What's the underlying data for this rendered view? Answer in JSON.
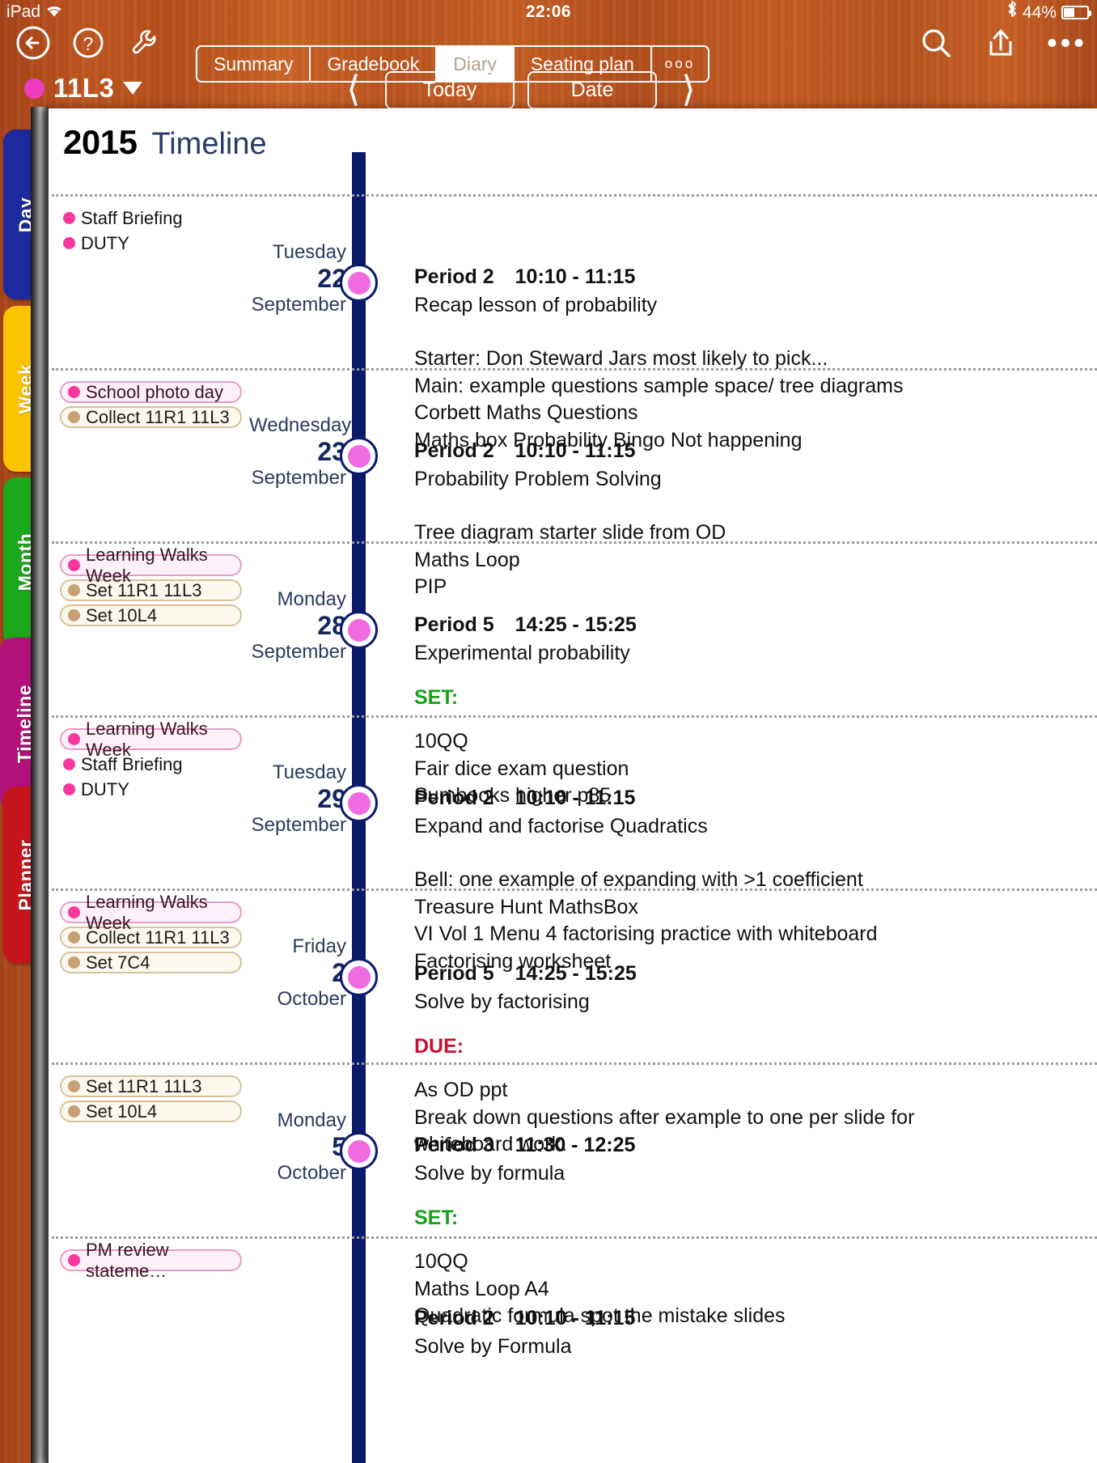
{
  "status_bar": {
    "device": "iPad",
    "wifi_icon": "wifi-icon",
    "time": "22:06",
    "bluetooth_icon": "bluetooth-icon",
    "battery_percent": "44%"
  },
  "toolbar": {
    "back_icon": "back-arrow-icon",
    "help_icon": "question-mark-icon",
    "tools_icon": "wrench-icon",
    "search_icon": "search-icon",
    "share_icon": "share-upload-icon",
    "more_icon": "more-ellipsis-icon",
    "segments": [
      {
        "label": "Summary",
        "active": false
      },
      {
        "label": "Gradebook",
        "active": false
      },
      {
        "label": "Diary",
        "active": true
      },
      {
        "label": "Seating plan",
        "active": false
      },
      {
        "label": "ooo",
        "active": false
      }
    ]
  },
  "nav": {
    "class_name": "11L3",
    "class_color": "#ef3dbf",
    "dropdown_icon": "chevron-down-icon",
    "prev_icon": "chevron-left-icon",
    "next_icon": "chevron-right-icon",
    "today_label": "Today",
    "date_label": "Date"
  },
  "sidebar": {
    "tabs": [
      {
        "label": "Day",
        "color": "#1d2a9e",
        "active": false
      },
      {
        "label": "Week",
        "color": "#fcc300",
        "active": false
      },
      {
        "label": "Month",
        "color": "#1ba81b",
        "active": false
      },
      {
        "label": "Timeline",
        "color": "#b2127a",
        "active": true
      },
      {
        "label": "Planner",
        "color": "#c4161c",
        "active": false
      }
    ]
  },
  "page": {
    "year": "2015",
    "view_title": "Timeline"
  },
  "timeline": {
    "days": [
      {
        "dow": "Tuesday",
        "day": "22",
        "month": "September",
        "events": [
          {
            "text": "Staff Briefing",
            "style": "plain",
            "dot": "pink"
          },
          {
            "text": "DUTY",
            "style": "plain",
            "dot": "pink"
          }
        ]
      },
      {
        "dow": "Wednesday",
        "day": "23",
        "month": "September",
        "events": [
          {
            "text": "School photo day",
            "style": "pill-pink",
            "dot": "pink"
          },
          {
            "text": "Collect 11R1 11L3",
            "style": "pill-tan",
            "dot": "tan"
          }
        ]
      },
      {
        "dow": "Monday",
        "day": "28",
        "month": "September",
        "events": [
          {
            "text": "Learning Walks Week",
            "style": "pill-pink",
            "dot": "pink"
          },
          {
            "text": "Set 11R1 11L3",
            "style": "pill-tan",
            "dot": "tan"
          },
          {
            "text": "Set 10L4",
            "style": "pill-tan",
            "dot": "tan"
          }
        ]
      },
      {
        "dow": "Tuesday",
        "day": "29",
        "month": "September",
        "events": [
          {
            "text": "Learning Walks Week",
            "style": "pill-pink",
            "dot": "pink"
          },
          {
            "text": "Staff Briefing",
            "style": "plain",
            "dot": "pink"
          },
          {
            "text": "DUTY",
            "style": "plain",
            "dot": "pink"
          }
        ]
      },
      {
        "dow": "Friday",
        "day": "2",
        "month": "October",
        "events": [
          {
            "text": "Learning Walks Week",
            "style": "pill-pink",
            "dot": "pink"
          },
          {
            "text": "Collect 11R1 11L3",
            "style": "pill-tan",
            "dot": "tan"
          },
          {
            "text": "Set 7C4",
            "style": "pill-tan",
            "dot": "tan"
          }
        ]
      },
      {
        "dow": "Monday",
        "day": "5",
        "month": "October",
        "events": [
          {
            "text": "Set 11R1 11L3",
            "style": "pill-tan",
            "dot": "tan"
          },
          {
            "text": "Set 10L4",
            "style": "pill-tan",
            "dot": "tan"
          }
        ]
      },
      {
        "dow": "",
        "day": "",
        "month": "",
        "events": [
          {
            "text": "PM review stateme…",
            "style": "pill-pink",
            "dot": "pink"
          }
        ]
      }
    ]
  },
  "lessons": [
    {
      "period": "Period 2",
      "time": "10:10 - 11:15",
      "title": "Recap lesson of probability",
      "notes": [
        "Starter: Don Steward Jars most likely to pick...",
        "Main: example questions sample space/ tree diagrams",
        "Corbett Maths Questions",
        "Maths box Probability Bingo Not happening"
      ]
    },
    {
      "period": "Period 2",
      "time": "10:10 - 11:15",
      "title": "Probability Problem Solving",
      "notes": [
        "Tree diagram starter slide from OD",
        "Maths Loop",
        "PIP"
      ]
    },
    {
      "period": "Period 5",
      "time": "14:25 - 15:25",
      "title": "Experimental probability",
      "tag": "SET:",
      "tag_kind": "set",
      "notes": [
        "10QQ",
        "Fair dice exam question",
        "Sumbooks higher p85"
      ]
    },
    {
      "period": "Period 2",
      "time": "10:10 - 11:15",
      "title": "Expand and factorise Quadratics",
      "notes": [
        "Bell: one example of expanding with >1 coefficient",
        "Treasure Hunt MathsBox",
        "VI Vol 1 Menu 4 factorising practice with whiteboard",
        "Factorising worksheet"
      ]
    },
    {
      "period": "Period 5",
      "time": "14:25 - 15:25",
      "title": "Solve by factorising",
      "tag": "DUE:",
      "tag_kind": "due",
      "notes": [
        "As OD ppt",
        "Break down questions after example to one per slide for",
        "whiteboard work."
      ]
    },
    {
      "period": "Period 3",
      "time": "11:30 - 12:25",
      "title": "Solve by formula",
      "tag": "SET:",
      "tag_kind": "set",
      "notes": [
        "10QQ",
        "Maths Loop A4",
        "Quadratic formula spot the mistake slides"
      ]
    },
    {
      "period": "Period 2",
      "time": "10:10 - 11:15",
      "title": "Solve by Formula",
      "notes": []
    }
  ]
}
